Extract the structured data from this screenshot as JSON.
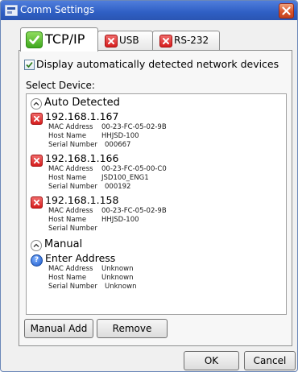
{
  "window": {
    "title": "Comm Settings"
  },
  "tabs": [
    {
      "label": "TCP/IP",
      "icon": "green-check-icon",
      "active": true
    },
    {
      "label": "USB",
      "icon": "red-x-icon",
      "active": false
    },
    {
      "label": "RS-232",
      "icon": "red-x-icon",
      "active": false
    }
  ],
  "options": {
    "display_auto_detected": {
      "label": "Display automatically detected network devices",
      "checked": true
    }
  },
  "device_list": {
    "label": "Select Device:",
    "groups": [
      {
        "label": "Auto Detected",
        "devices": [
          {
            "ip": "192.168.1.167",
            "mac_label": "MAC Address",
            "mac": "00-23-FC-05-02-9B",
            "host_label": "Host Name",
            "host": "HHJSD-100",
            "serial_label": "Serial Number",
            "serial": "000667"
          },
          {
            "ip": "192.168.1.166",
            "mac_label": "MAC Address",
            "mac": "00-23-FC-05-00-C0",
            "host_label": "Host Name",
            "host": "JSD100_ENG1",
            "serial_label": "Serial Number",
            "serial": "000192"
          },
          {
            "ip": "192.168.1.158",
            "mac_label": "MAC Address",
            "mac": "00-23-FC-05-02-9B",
            "host_label": "Host Name",
            "host": "HHJSD-100",
            "serial_label": "Serial Number",
            "serial": ""
          }
        ]
      },
      {
        "label": "Manual",
        "devices": [
          {
            "ip": "Enter Address",
            "mac_label": "MAC Address",
            "mac": "Unknown",
            "host_label": "Host Name",
            "host": "Unknown",
            "serial_label": "Serial Number",
            "serial": "Unknown"
          }
        ]
      }
    ]
  },
  "buttons": {
    "manual_add": "Manual Add",
    "remove": "Remove",
    "ok": "OK",
    "cancel": "Cancel"
  },
  "colors": {
    "title_bar": "#3464cc",
    "status_error": "#d61e1e",
    "status_ok": "#3fa81d",
    "help": "#1a56c9"
  }
}
